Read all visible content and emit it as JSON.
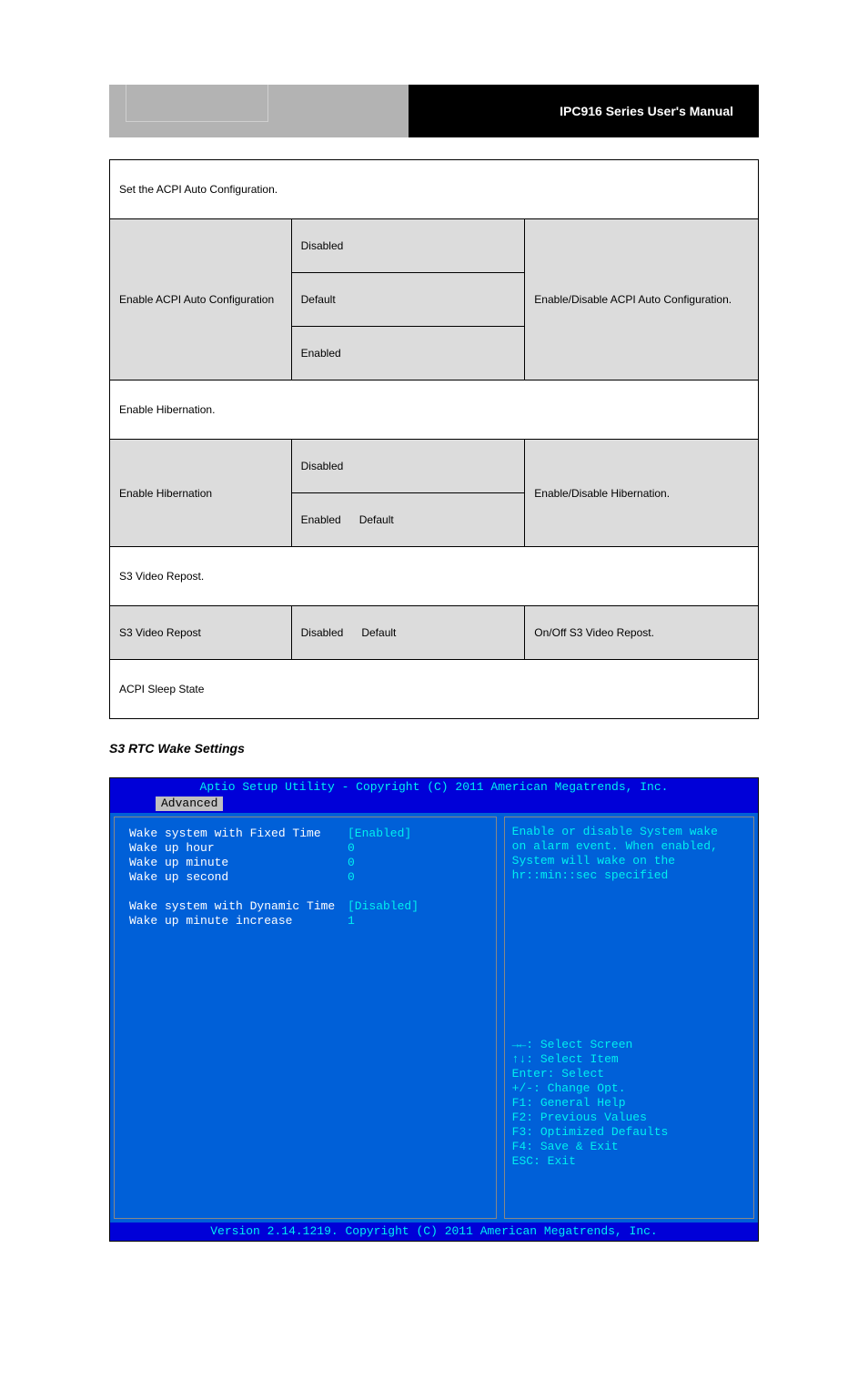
{
  "banner": {
    "right_title": "IPC916 Series User's Manual"
  },
  "table1": {
    "heading": "Set the ACPI Auto Configuration.",
    "r1_label": "Enable ACPI Auto Configuration",
    "r1_opts": [
      "Disabled",
      "Default",
      "Enabled"
    ],
    "r1_desc": "Enable/Disable ACPI Auto Configuration.",
    "heading2": "Enable Hibernation.",
    "r2_label": "Enable Hibernation",
    "r2_opts": [
      "Disabled",
      "Enabled",
      "Default"
    ],
    "r2_desc": "Enable/Disable Hibernation.",
    "heading3": "S3 Video Repost.",
    "r3_label": "S3 Video Repost",
    "r3_opts_line1": "Disabled",
    "r3_opts_line2": "Default",
    "r3_desc": "On/Off S3 Video Repost.",
    "heading4": "ACPI Sleep State"
  },
  "subhead": "S3 RTC Wake Settings",
  "bios": {
    "topbar": "Aptio Setup Utility - Copyright (C) 2011 American Megatrends, Inc.",
    "tab_active": "Advanced",
    "rows": [
      {
        "label": "Wake system with Fixed Time",
        "value": "[Enabled]"
      },
      {
        "label": "Wake up hour",
        "value": "0"
      },
      {
        "label": "Wake up minute",
        "value": "0"
      },
      {
        "label": "Wake up second",
        "value": "0"
      },
      {
        "label": "",
        "value": ""
      },
      {
        "label": "Wake system with Dynamic Time",
        "value": "[Disabled]"
      },
      {
        "label": "Wake up minute increase",
        "value": "1"
      }
    ],
    "help": [
      "Enable or disable System wake",
      "on alarm event. When enabled,",
      "System will wake on the",
      "hr::min::sec specified"
    ],
    "keys": [
      "→←: Select Screen",
      "↑↓: Select Item",
      "Enter: Select",
      "+/-: Change Opt.",
      "F1: General Help",
      "F2: Previous Values",
      "F3: Optimized Defaults",
      "F4: Save & Exit",
      "ESC: Exit"
    ],
    "bottombar": "Version 2.14.1219. Copyright (C) 2011 American Megatrends, Inc."
  }
}
